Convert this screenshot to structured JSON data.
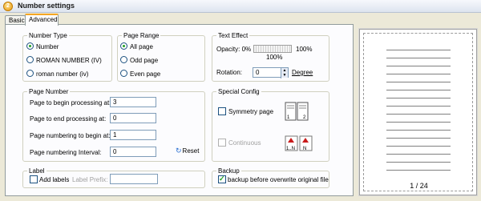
{
  "window": {
    "title": "Number settings",
    "icon": "2"
  },
  "tabs": [
    {
      "label": "Basic"
    },
    {
      "label": "Advanced"
    }
  ],
  "number_type": {
    "title": "Number Type",
    "options": [
      {
        "label": "Number",
        "selected": true
      },
      {
        "label": "ROMAN NUMBER (IV)",
        "selected": false
      },
      {
        "label": "roman number (iv)",
        "selected": false
      }
    ]
  },
  "page_range": {
    "title": "Page Range",
    "options": [
      {
        "label": "All page",
        "selected": true
      },
      {
        "label": "Odd page",
        "selected": false
      },
      {
        "label": "Even page",
        "selected": false
      }
    ]
  },
  "text_effect": {
    "title": "Text Effect",
    "opacity_label": "Opacity: 0%",
    "opacity_max": "100%",
    "opacity_value": "100%",
    "opacity_fraction": 1.0,
    "rotation_label": "Rotation:",
    "rotation_value": "0",
    "rotation_unit": "Degree"
  },
  "page_number": {
    "title": "Page Number",
    "fields": [
      {
        "label": "Page to begin processing at:",
        "value": "3"
      },
      {
        "label": "Page to end processing at:",
        "value": "0"
      },
      {
        "label": "Page numbering to begin at:",
        "value": "1"
      },
      {
        "label": "Page numbering Interval:",
        "value": "0"
      }
    ],
    "reset_label": "Reset"
  },
  "special_config": {
    "title": "Special Config",
    "symmetry_label": "Symmetry page",
    "symmetry_checked": false,
    "continuous_label": "Continuous",
    "continuous_checked": false
  },
  "label": {
    "title": "Label",
    "add_labels": "Add labels",
    "add_labels_checked": false,
    "prefix_label": "Label Prefix:",
    "prefix_value": ""
  },
  "backup": {
    "title": "Backup",
    "checkbox_label": "backup before overwrite original file",
    "checked": true
  },
  "preview": {
    "page_indicator": "1 / 24"
  },
  "colors": {
    "accent_tab": "#f5a623",
    "radio_dot": "#21a121",
    "border": "#919b9c"
  }
}
